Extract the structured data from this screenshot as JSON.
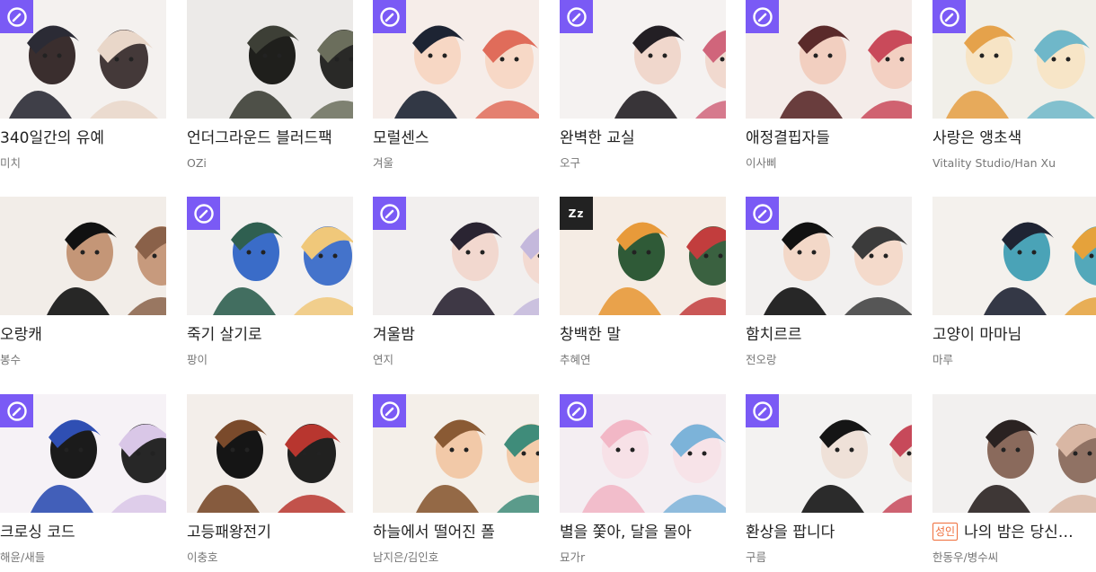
{
  "accent_color": "#7a5af5",
  "cards": [
    {
      "title": "340일간의 유예",
      "author": "미치",
      "badge": "clock-icon",
      "palette": [
        "#f4f1ef",
        "#2b2b35",
        "#e9d7c9",
        "#3a2e2e"
      ]
    },
    {
      "title": "언더그라운드 블러드팩",
      "author": "OZi",
      "badge": "",
      "palette": [
        "#eceae8",
        "#3d3f36",
        "#6b6e5c",
        "#1f1f1c"
      ]
    },
    {
      "title": "모럴센스",
      "author": "겨울",
      "badge": "clock-icon",
      "palette": [
        "#f6ede9",
        "#1d2433",
        "#e06c5a",
        "#f7d7c4"
      ]
    },
    {
      "title": "완벽한 교실",
      "author": "오구",
      "badge": "clock-icon",
      "palette": [
        "#f5f2f1",
        "#231f24",
        "#d0657b",
        "#f0d7cc"
      ]
    },
    {
      "title": "애정결핍자들",
      "author": "이사삐",
      "badge": "clock-icon",
      "palette": [
        "#f4ece9",
        "#5a2a2a",
        "#c94a5a",
        "#f2cfc0"
      ]
    },
    {
      "title": "사랑은 앵초색",
      "author": "Vitality Studio/Han Xu",
      "badge": "clock-icon",
      "palette": [
        "#f1efe9",
        "#e5a24b",
        "#6fb7c9",
        "#f7e4c5"
      ]
    },
    {
      "title": "오랑캐",
      "author": "봉수",
      "badge": "",
      "palette": [
        "#f2ede8",
        "#111111",
        "#8a6149",
        "#c49677"
      ]
    },
    {
      "title": "죽기 살기로",
      "author": "팡이",
      "badge": "clock-icon",
      "palette": [
        "#f3f1f0",
        "#2f5f50",
        "#f0c87a",
        "#3a6cc8"
      ]
    },
    {
      "title": "겨울밤",
      "author": "연지",
      "badge": "clock-icon",
      "palette": [
        "#f2efee",
        "#2a2432",
        "#c4b8dc",
        "#f2d8cf"
      ]
    },
    {
      "title": "창백한 말",
      "author": "추혜연",
      "badge": "zz",
      "palette": [
        "#f5ece4",
        "#e89a3a",
        "#c23d3d",
        "#2f5a37"
      ]
    },
    {
      "title": "함치르르",
      "author": "전오랑",
      "badge": "clock-icon",
      "palette": [
        "#f2f0ef",
        "#111111",
        "#3b3b3b",
        "#f3d8c8"
      ]
    },
    {
      "title": "고양이 마마님",
      "author": "마루",
      "badge": "",
      "palette": [
        "#f4f1ed",
        "#1f2433",
        "#e5a23b",
        "#4aa3b7"
      ]
    },
    {
      "title": "크로싱 코드",
      "author": "해윤/새들",
      "badge": "clock-icon",
      "palette": [
        "#f6f2f6",
        "#2f4fb3",
        "#d9c7e7",
        "#1b1b1b"
      ]
    },
    {
      "title": "고등패왕전기",
      "author": "이충호",
      "badge": "",
      "palette": [
        "#f3eeea",
        "#7a4a2b",
        "#b8362f",
        "#151515"
      ]
    },
    {
      "title": "하늘에서 떨어진 폴",
      "author": "남지은/김인호",
      "badge": "clock-icon",
      "palette": [
        "#f4efe9",
        "#8a5a34",
        "#3f8c7a",
        "#f2c9a8"
      ]
    },
    {
      "title": "별을 쫓아, 달을 몰아",
      "author": "묘가r",
      "badge": "clock-icon",
      "palette": [
        "#f4eef2",
        "#f2b7c6",
        "#7cb3d9",
        "#f7e1e7"
      ]
    },
    {
      "title": "환상을 팝니다",
      "author": "구름",
      "badge": "clock-icon",
      "palette": [
        "#f3f2f1",
        "#151515",
        "#c7495a",
        "#efe1d8"
      ]
    },
    {
      "title": "나의 밤은 당신…",
      "author": "한동우/병수씨",
      "badge": "",
      "adult_label": "성인",
      "palette": [
        "#f2f0ef",
        "#2a2221",
        "#d9b7a4",
        "#8a6a5c"
      ]
    }
  ]
}
